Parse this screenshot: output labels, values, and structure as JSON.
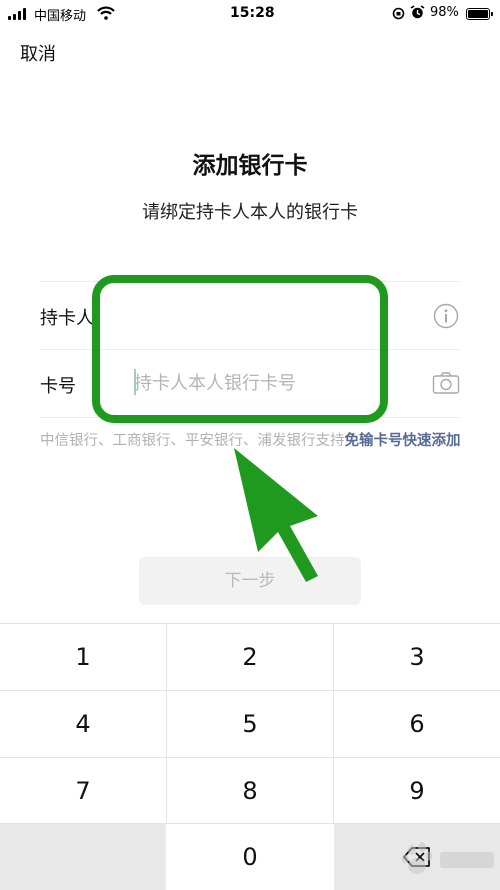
{
  "status_bar": {
    "carrier": "中国移动",
    "time": "15:28",
    "battery": "98%",
    "battery_level": 0.98
  },
  "nav": {
    "cancel_label": "取消"
  },
  "header": {
    "title": "添加银行卡",
    "subtitle": "请绑定持卡人本人的银行卡"
  },
  "form": {
    "holder_label": "持卡人",
    "holder_value": "",
    "card_label": "卡号",
    "card_placeholder": "持卡人本人银行卡号"
  },
  "support": {
    "text": "中信银行、工商银行、平安银行、浦发银行支持",
    "link": "免输卡号快速添加"
  },
  "next_button_label": "下一步",
  "keypad": {
    "keys": [
      "1",
      "2",
      "3",
      "4",
      "5",
      "6",
      "7",
      "8",
      "9",
      "0"
    ]
  },
  "annotation": {
    "color": "#1f9a1f"
  },
  "colors": {
    "link": "#576b95",
    "placeholder": "#b5b5b5",
    "button_bg": "#f2f2f2"
  }
}
